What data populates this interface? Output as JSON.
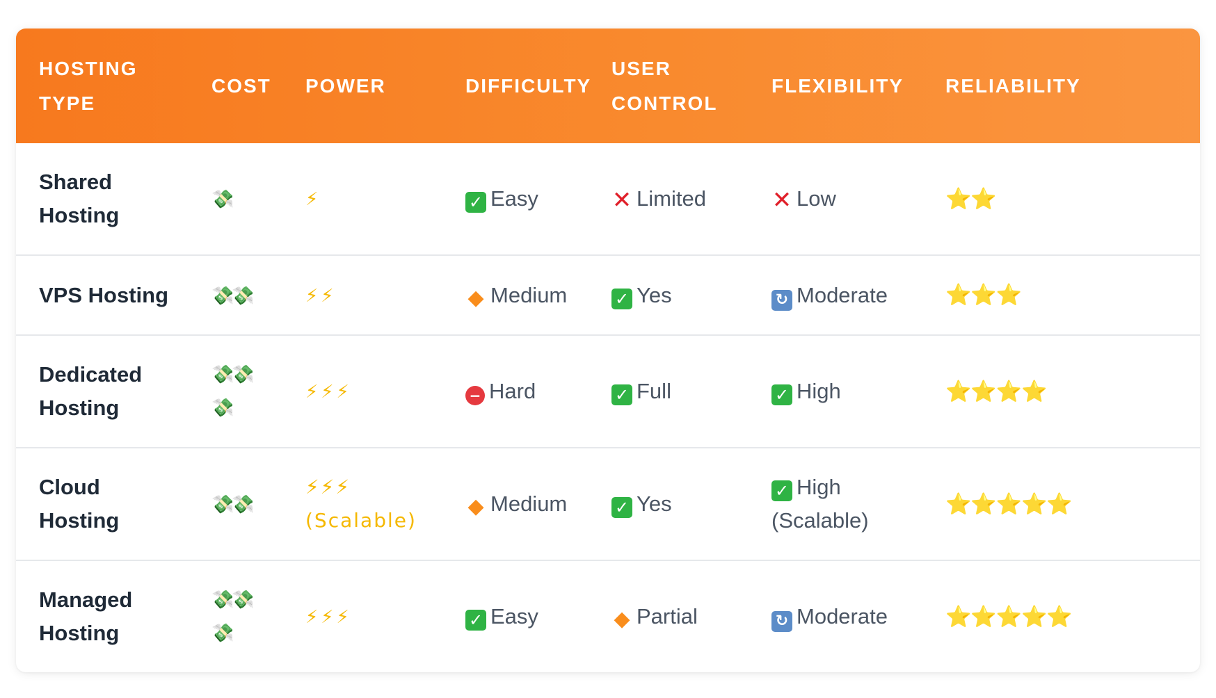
{
  "headers": {
    "type": "HOSTING TYPE",
    "cost": "COST",
    "power": "POWER",
    "difficulty": "DIFFICULTY",
    "control": "USER CONTROL",
    "flexibility": "FLEXIBILITY",
    "reliability": "RELIABILITY"
  },
  "colors": {
    "header_gradient_start": "#f7791e",
    "header_gradient_end": "#fa9540",
    "check": "#2fb344",
    "cross": "#e0202a",
    "diamond": "#f98d1c"
  },
  "rows": [
    {
      "type": "Shared Hosting",
      "cost": "💸",
      "power": "⚡",
      "difficulty": {
        "icon": "check-mark-button-icon",
        "glyph": "✓",
        "label": "Easy"
      },
      "control": {
        "icon": "cross-mark-icon",
        "glyph": "✕",
        "label": "Limited"
      },
      "flexibility": {
        "icon": "cross-mark-icon",
        "glyph": "✕",
        "label": "Low"
      },
      "reliability": "⭐⭐"
    },
    {
      "type": "VPS Hosting",
      "cost": "💸💸",
      "power": "⚡⚡",
      "difficulty": {
        "icon": "orange-diamond-icon",
        "glyph": "◆",
        "label": "Medium"
      },
      "control": {
        "icon": "check-mark-button-icon",
        "glyph": "✓",
        "label": "Yes"
      },
      "flexibility": {
        "icon": "refresh-icon",
        "glyph": "↻",
        "label": "Moderate"
      },
      "reliability": "⭐⭐⭐"
    },
    {
      "type": "Dedicated Hosting",
      "cost": "💸💸💸",
      "power": "⚡⚡⚡",
      "difficulty": {
        "icon": "no-entry-icon",
        "glyph": "−",
        "label": "Hard"
      },
      "control": {
        "icon": "check-mark-button-icon",
        "glyph": "✓",
        "label": "Full"
      },
      "flexibility": {
        "icon": "check-mark-button-icon",
        "glyph": "✓",
        "label": "High"
      },
      "reliability": "⭐⭐⭐⭐"
    },
    {
      "type": "Cloud Hosting",
      "cost": "💸💸",
      "power": "⚡⚡⚡ (Scalable)",
      "difficulty": {
        "icon": "orange-diamond-icon",
        "glyph": "◆",
        "label": "Medium"
      },
      "control": {
        "icon": "check-mark-button-icon",
        "glyph": "✓",
        "label": "Yes"
      },
      "flexibility": {
        "icon": "check-mark-button-icon",
        "glyph": "✓",
        "label": "High (Scalable)"
      },
      "reliability": "⭐⭐⭐⭐⭐"
    },
    {
      "type": "Managed Hosting",
      "cost": "💸💸💸",
      "power": "⚡⚡⚡",
      "difficulty": {
        "icon": "check-mark-button-icon",
        "glyph": "✓",
        "label": "Easy"
      },
      "control": {
        "icon": "orange-diamond-icon",
        "glyph": "◆",
        "label": "Partial"
      },
      "flexibility": {
        "icon": "refresh-icon",
        "glyph": "↻",
        "label": "Moderate"
      },
      "reliability": "⭐⭐⭐⭐⭐"
    }
  ]
}
